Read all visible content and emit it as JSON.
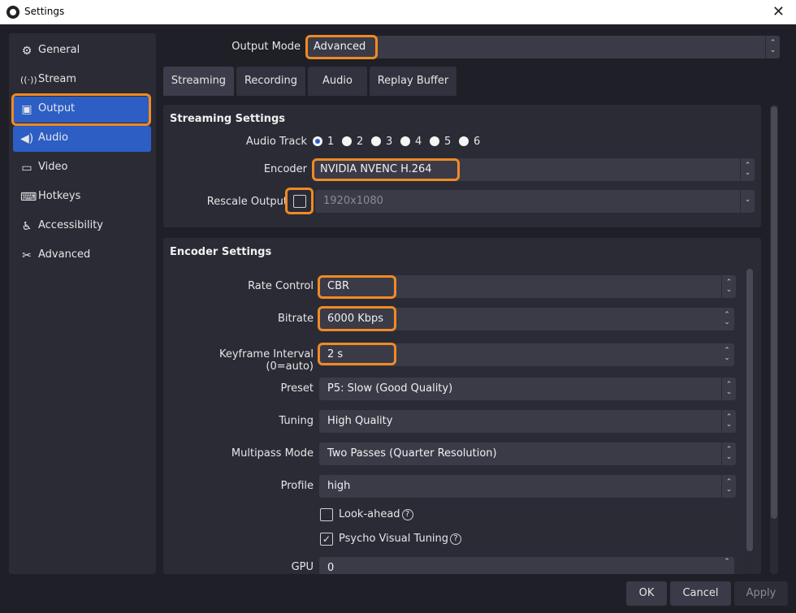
{
  "window": {
    "title": "Settings",
    "close_glyph": "✕"
  },
  "sidebar": {
    "items": [
      {
        "label": "General",
        "icon": "gear-icon",
        "glyph": "⚙"
      },
      {
        "label": "Stream",
        "icon": "antenna-icon",
        "glyph": "📡"
      },
      {
        "label": "Output",
        "icon": "output-icon",
        "glyph": "▣"
      },
      {
        "label": "Audio",
        "icon": "speaker-icon",
        "glyph": "🔊"
      },
      {
        "label": "Video",
        "icon": "monitor-icon",
        "glyph": "▭"
      },
      {
        "label": "Hotkeys",
        "icon": "keyboard-icon",
        "glyph": "⌨"
      },
      {
        "label": "Accessibility",
        "icon": "accessibility-icon",
        "glyph": "♿"
      },
      {
        "label": "Advanced",
        "icon": "tools-icon",
        "glyph": "✂"
      }
    ]
  },
  "output_mode": {
    "label": "Output Mode",
    "value": "Advanced"
  },
  "tabs": [
    "Streaming",
    "Recording",
    "Audio",
    "Replay Buffer"
  ],
  "streaming": {
    "title": "Streaming Settings",
    "audio_track": {
      "label": "Audio Track",
      "options": [
        "1",
        "2",
        "3",
        "4",
        "5",
        "6"
      ],
      "selected": "1"
    },
    "encoder": {
      "label": "Encoder",
      "value": "NVIDIA NVENC H.264"
    },
    "rescale": {
      "label": "Rescale Output",
      "checked": false,
      "value": "1920x1080"
    }
  },
  "encoder_settings": {
    "title": "Encoder Settings",
    "rate_control": {
      "label": "Rate Control",
      "value": "CBR"
    },
    "bitrate": {
      "label": "Bitrate",
      "value": "6000 Kbps"
    },
    "keyframe": {
      "label": "Keyframe Interval (0=auto)",
      "value": "2 s"
    },
    "preset": {
      "label": "Preset",
      "value": "P5: Slow (Good Quality)"
    },
    "tuning": {
      "label": "Tuning",
      "value": "High Quality"
    },
    "multipass": {
      "label": "Multipass Mode",
      "value": "Two Passes (Quarter Resolution)"
    },
    "profile": {
      "label": "Profile",
      "value": "high"
    },
    "look_ahead": {
      "label": "Look-ahead",
      "checked": false
    },
    "psycho_visual": {
      "label": "Psycho Visual Tuning",
      "checked": true
    },
    "gpu": {
      "label": "GPU",
      "value": "0"
    }
  },
  "buttons": {
    "ok": "OK",
    "cancel": "Cancel",
    "apply": "Apply"
  },
  "colors": {
    "accent": "#2c5ec4",
    "highlight": "#f08a24",
    "background": "#1f1f27"
  }
}
